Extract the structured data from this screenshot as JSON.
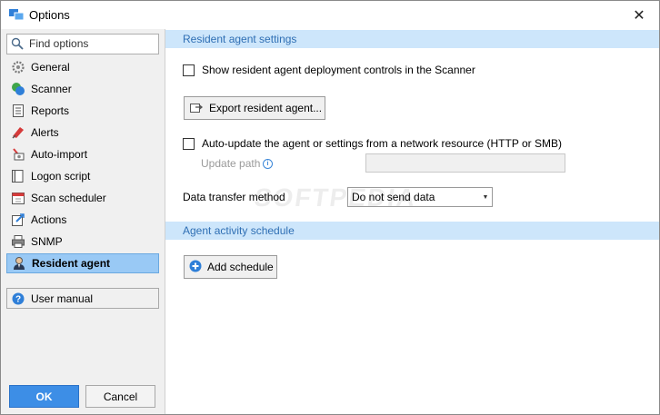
{
  "window": {
    "title": "Options",
    "close_glyph": "✕"
  },
  "sidebar": {
    "search_placeholder": "Find options",
    "items": [
      {
        "label": "General",
        "icon": "gear-icon"
      },
      {
        "label": "Scanner",
        "icon": "scanner-icon"
      },
      {
        "label": "Reports",
        "icon": "report-icon"
      },
      {
        "label": "Alerts",
        "icon": "alert-icon"
      },
      {
        "label": "Auto-import",
        "icon": "auto-import-icon"
      },
      {
        "label": "Logon script",
        "icon": "script-icon"
      },
      {
        "label": "Scan scheduler",
        "icon": "calendar-icon"
      },
      {
        "label": "Actions",
        "icon": "actions-icon"
      },
      {
        "label": "SNMP",
        "icon": "printer-icon"
      },
      {
        "label": "Resident agent",
        "icon": "agent-icon",
        "selected": true
      }
    ],
    "user_manual_label": "User manual",
    "ok_label": "OK",
    "cancel_label": "Cancel"
  },
  "main": {
    "section1_title": "Resident agent settings",
    "show_controls_label": "Show resident agent deployment controls in the Scanner",
    "export_button_label": "Export resident agent...",
    "auto_update_label": "Auto-update the agent or settings from a network resource (HTTP or SMB)",
    "update_path_label": "Update path",
    "update_path_value": "",
    "data_transfer_label": "Data transfer method",
    "data_transfer_value": "Do not send data",
    "section2_title": "Agent activity schedule",
    "add_schedule_label": "Add schedule"
  },
  "watermark": "SOFTPEDIA",
  "colors": {
    "accent": "#3d8ee6",
    "selected_bg": "#99c9f5",
    "section_bg": "#cde6fb",
    "section_text": "#2f6fb4"
  }
}
